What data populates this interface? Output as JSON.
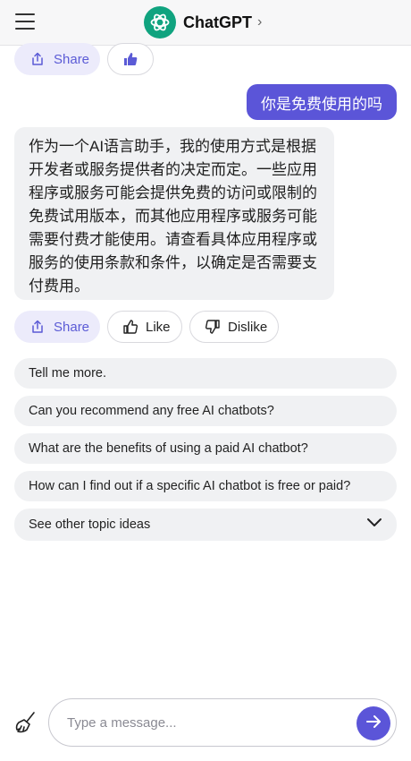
{
  "header": {
    "title": "ChatGPT",
    "chevron": "›",
    "menu_icon": "hamburger-menu-icon",
    "logo_icon": "chatgpt-logo-icon"
  },
  "top_actions": {
    "share_label": "Share",
    "like_icon": "thumbs-up-filled-icon"
  },
  "conversation": {
    "user_message": "你是免费使用的吗",
    "bot_message": "作为一个AI语言助手，我的使用方式是根据开发者或服务提供者的决定而定。一些应用程序或服务可能会提供免费的访问或限制的免费试用版本，而其他应用程序或服务可能需要付费才能使用。请查看具体应用程序或服务的使用条款和条件，以确定是否需要支付费用。"
  },
  "message_actions": {
    "share_label": "Share",
    "like_label": "Like",
    "dislike_label": "Dislike"
  },
  "suggestions": [
    "Tell me more.",
    "Can you recommend any free AI chatbots?",
    "What are the benefits of using a paid AI chatbot?",
    "How can I find out if a specific AI chatbot is free or paid?"
  ],
  "more_topics": {
    "label": "See other topic ideas",
    "icon": "chevron-down-icon"
  },
  "composer": {
    "placeholder": "Type a message...",
    "value": "",
    "clear_icon": "broom-icon",
    "send_icon": "arrow-right-icon"
  },
  "colors": {
    "accent": "#5b55d8",
    "share_bg": "#ecebfb",
    "bubble_bg": "#f0f1f3",
    "brand_green": "#10a37f"
  }
}
